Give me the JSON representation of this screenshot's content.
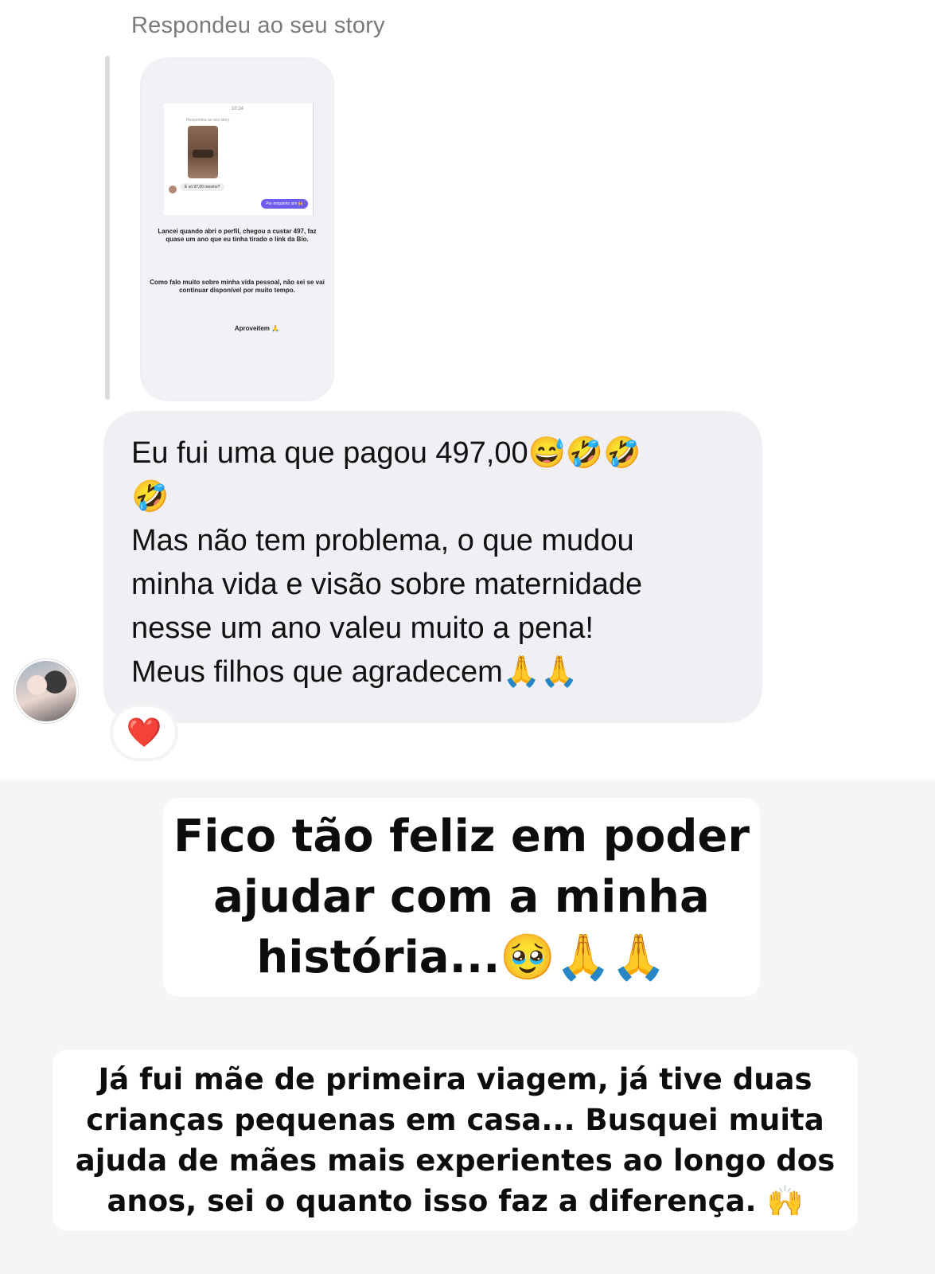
{
  "reply_header": "Respondeu ao seu story",
  "story_preview": {
    "mini_time": "10:24",
    "mini_header": "Respondeu ao seu story",
    "mini_left_message": "É só 97,00 mesmo?",
    "mini_right_message": "Por enquanto sim 🙌",
    "text_1": "Lancei quando abri o perfil, chegou a custar 497, faz quase um ano que eu tinha tirado o link da Bio.",
    "text_2": "Como falo muito sobre minha vida pessoal, não sei se vai continuar disponível por muito tempo.",
    "text_3": "Aproveitem 🙏"
  },
  "message": {
    "text": "Eu fui uma que pagou 497,00😅🤣🤣\n🤣\nMas não tem problema, o que mudou\nminha vida e visão sobre maternidade\nnesse um ano valeu muito a pena!\nMeus filhos que agradecem🙏🙏",
    "reaction": "❤️"
  },
  "caption_1": "Fico tão feliz em poder\najudar com a minha\nhistória...🥹🙏🙏",
  "caption_2": "Já fui mãe de primeira viagem, já tive duas\ncrianças pequenas em casa... Busquei muita\najuda de mães mais experientes ao longo dos\nanos, sei o quanto isso faz a diferença. 🙌"
}
